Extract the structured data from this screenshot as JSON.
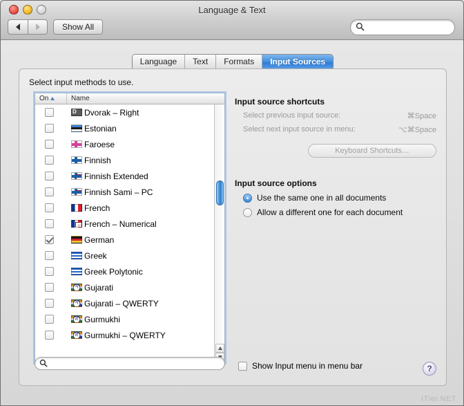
{
  "window": {
    "title": "Language & Text",
    "traffic": {
      "close": "close-button",
      "minimize": "minimize-button",
      "zoom": "zoom-button"
    }
  },
  "toolbar": {
    "back_label": "◀",
    "forward_label": "▶",
    "show_all_label": "Show All",
    "search_placeholder": "",
    "search_value": ""
  },
  "tabs": [
    {
      "label": "Language",
      "selected": false
    },
    {
      "label": "Text",
      "selected": false
    },
    {
      "label": "Formats",
      "selected": false
    },
    {
      "label": "Input Sources",
      "selected": true
    }
  ],
  "main": {
    "caption": "Select input methods to use.",
    "columns": {
      "on": "On",
      "name": "Name",
      "sort": "ascending"
    },
    "rows": [
      {
        "name": "Dvorak – Right",
        "checked": false,
        "icon": "flag-dvorak"
      },
      {
        "name": "Estonian",
        "checked": false,
        "icon": "flag-estonia"
      },
      {
        "name": "Faroese",
        "checked": false,
        "icon": "flag-faroe"
      },
      {
        "name": "Finnish",
        "checked": false,
        "icon": "flag-finland"
      },
      {
        "name": "Finnish Extended",
        "checked": false,
        "icon": "flag-finland-badge"
      },
      {
        "name": "Finnish Sami – PC",
        "checked": false,
        "icon": "flag-finland-badge"
      },
      {
        "name": "French",
        "checked": false,
        "icon": "flag-france"
      },
      {
        "name": "French – Numerical",
        "checked": false,
        "icon": "flag-france-numeric"
      },
      {
        "name": "German",
        "checked": true,
        "icon": "flag-germany"
      },
      {
        "name": "Greek",
        "checked": false,
        "icon": "flag-greece"
      },
      {
        "name": "Greek Polytonic",
        "checked": false,
        "icon": "flag-greece-polytonic"
      },
      {
        "name": "Gujarati",
        "checked": false,
        "icon": "flag-india-gujarati"
      },
      {
        "name": "Gujarati – QWERTY",
        "checked": false,
        "icon": "flag-india-gujarati-qwerty"
      },
      {
        "name": "Gurmukhi",
        "checked": false,
        "icon": "flag-india-gurmukhi"
      },
      {
        "name": "Gurmukhi – QWERTY",
        "checked": false,
        "icon": "flag-india-gurmukhi-qwerty"
      }
    ],
    "shortcuts": {
      "title": "Input source shortcuts",
      "items": [
        {
          "label": "Select previous input source:",
          "key": "⌘Space"
        },
        {
          "label": "Select next input source in menu:",
          "key": "⌥⌘Space"
        }
      ],
      "button_label": "Keyboard Shortcuts…"
    },
    "options": {
      "title": "Input source options",
      "choices": [
        {
          "label": "Use the same one in all documents",
          "selected": true
        },
        {
          "label": "Allow a different one for each document",
          "selected": false
        }
      ]
    },
    "filter": {
      "placeholder": "",
      "value": ""
    },
    "show_menu": {
      "label": "Show Input menu in menu bar",
      "checked": false
    },
    "help_label": "?"
  },
  "watermark": "ITler.NET",
  "colors": {
    "accent": "#3f8ee0",
    "selected_tab": "#2f79d4",
    "focus_ring": "#7eacde",
    "window_bg": "#e2e2e2",
    "help_tint": "#c3bcdd"
  }
}
